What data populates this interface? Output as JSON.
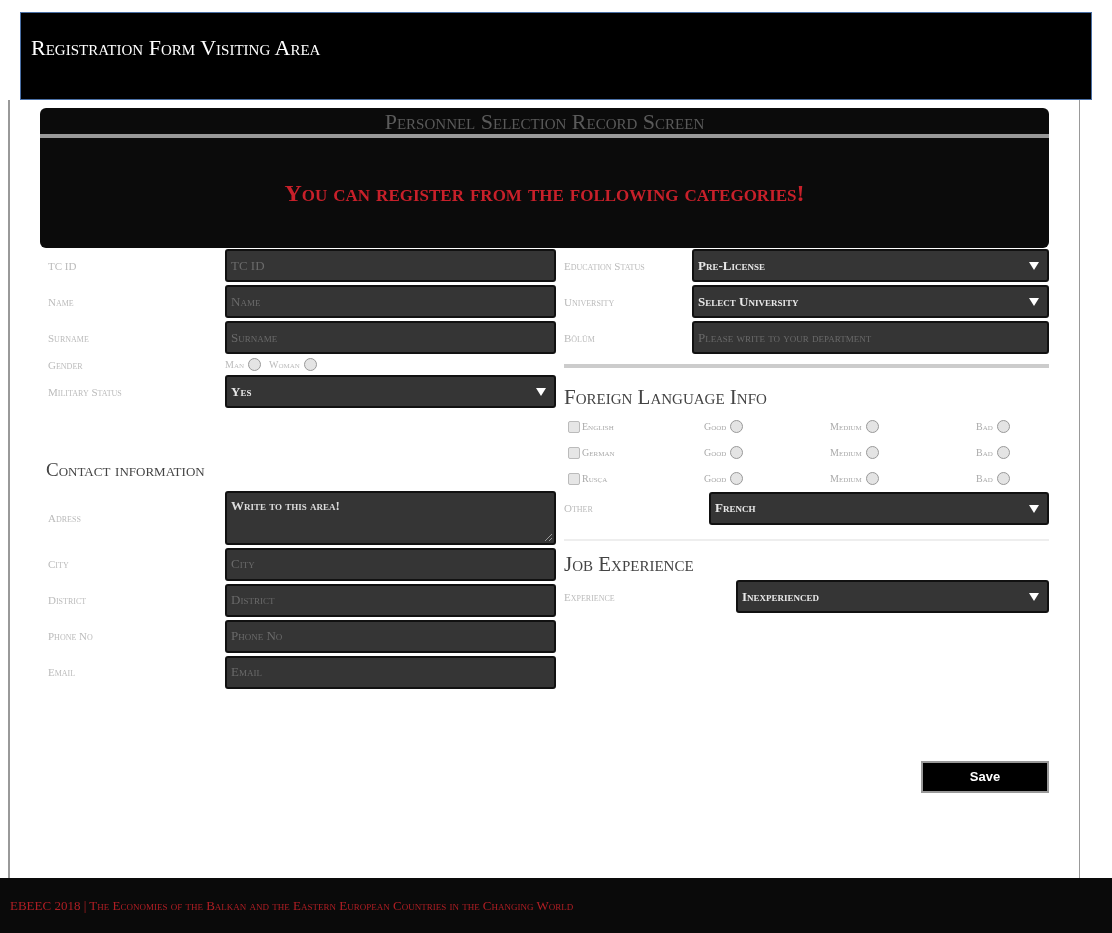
{
  "header": {
    "title": "Registration Form Visiting Area"
  },
  "panel": {
    "title": "Personnel Selection Record Screen",
    "notice": "You can register from the following categories!"
  },
  "personal": {
    "fields": [
      {
        "kind": "input",
        "label": "TC ID",
        "placeholder": "TC ID"
      },
      {
        "kind": "input",
        "label": "Name",
        "placeholder": "Name"
      },
      {
        "kind": "input",
        "label": "Surname",
        "placeholder": "Surname"
      },
      {
        "kind": "radios",
        "label": "Gender",
        "options": [
          {
            "label": "Man",
            "selected": false
          },
          {
            "label": "Woman",
            "selected": false
          }
        ]
      },
      {
        "kind": "select",
        "label": "Military Status",
        "value": "Yes"
      }
    ]
  },
  "contact": {
    "title": "Contact information",
    "fields": [
      {
        "kind": "textarea",
        "label": "Adress",
        "value": "Write to this area!"
      },
      {
        "kind": "input",
        "label": "City",
        "placeholder": "City"
      },
      {
        "kind": "input",
        "label": "District",
        "placeholder": "District"
      },
      {
        "kind": "input",
        "label": "Phone No",
        "placeholder": "Phone No"
      },
      {
        "kind": "input",
        "label": "Email",
        "placeholder": "Email"
      }
    ]
  },
  "education": {
    "fields": [
      {
        "kind": "select",
        "label": "Education Status",
        "value": "Pre-License"
      },
      {
        "kind": "select",
        "label": "University",
        "value": "Select University"
      },
      {
        "kind": "input",
        "label": "Bölüm",
        "placeholder": "Please write to your department"
      }
    ]
  },
  "languages": {
    "title": "Foreign Language Info",
    "rows": [
      {
        "label": "English",
        "checked": false,
        "levels": [
          {
            "label": "Good",
            "selected": false
          },
          {
            "label": "Medium",
            "selected": false
          },
          {
            "label": "Bad",
            "selected": false
          }
        ]
      },
      {
        "label": "German",
        "checked": false,
        "levels": [
          {
            "label": "Good",
            "selected": false
          },
          {
            "label": "Medium",
            "selected": false
          },
          {
            "label": "Bad",
            "selected": false
          }
        ]
      },
      {
        "label": "Rusça",
        "checked": false,
        "levels": [
          {
            "label": "Good",
            "selected": false
          },
          {
            "label": "Medium",
            "selected": false
          },
          {
            "label": "Bad",
            "selected": false
          }
        ]
      }
    ],
    "other": {
      "label": "Other",
      "value": "French"
    }
  },
  "job": {
    "title": "Job Experience",
    "field": {
      "label": "Experience",
      "value": "Inexperienced"
    }
  },
  "save_button": "Save",
  "footer": "EBEEC 2018 | The Economies of the Balkan and the Eastern European Countries in the Changing World"
}
